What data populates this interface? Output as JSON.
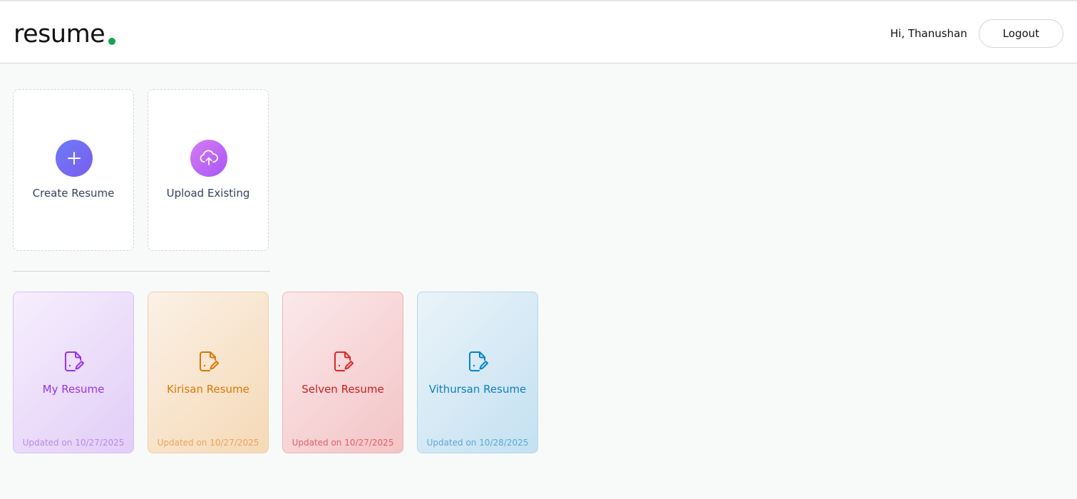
{
  "header": {
    "logo_text": "resume",
    "logo_dot_color": "#16a34a",
    "greeting": "Hi, Thanushan",
    "logout_label": "Logout"
  },
  "actions": [
    {
      "label": "Create Resume",
      "icon": "plus-icon",
      "color": "#6b7cf6"
    },
    {
      "label": "Upload Existing",
      "icon": "cloud-upload-icon",
      "color": "#c06af5"
    }
  ],
  "resumes": [
    {
      "title": "My Resume",
      "updated": "Updated on 10/27/2025",
      "color": "#9333ea"
    },
    {
      "title": "Kirisan Resume",
      "updated": "Updated on 10/27/2025",
      "color": "#d97706"
    },
    {
      "title": "Selven Resume",
      "updated": "Updated on 10/27/2025",
      "color": "#dc2626"
    },
    {
      "title": "Vithursan Resume",
      "updated": "Updated on 10/28/2025",
      "color": "#0284c7"
    }
  ]
}
